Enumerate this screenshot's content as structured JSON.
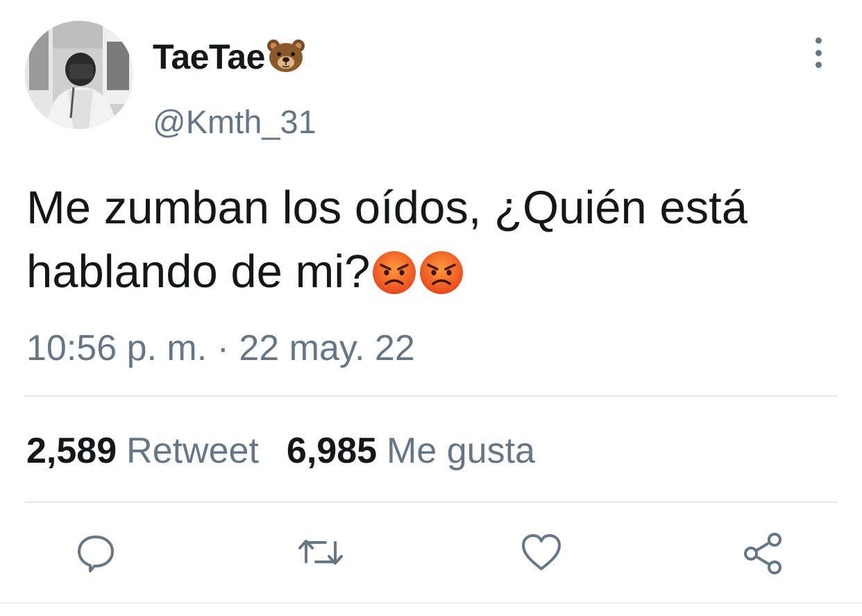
{
  "user": {
    "display_name": "TaeTae",
    "display_name_emoji": "bear-face-emoji",
    "handle": "@Kmth_31"
  },
  "tweet": {
    "text": "Me zumban los oídos, ¿Quién está hablando de mi?",
    "trailing_emojis": [
      "angry-face-emoji",
      "angry-face-emoji"
    ],
    "timestamp": "10:56 p. m. · 22 may. 22"
  },
  "stats": {
    "retweet_count": "2,589",
    "retweet_label": "Retweet",
    "like_count": "6,985",
    "like_label": "Me gusta"
  },
  "actions": [
    "reply-icon",
    "retweet-icon",
    "like-icon",
    "share-icon"
  ],
  "colors": {
    "text_primary": "#14171a",
    "text_secondary": "#657786",
    "divider": "#e1e8ed"
  }
}
